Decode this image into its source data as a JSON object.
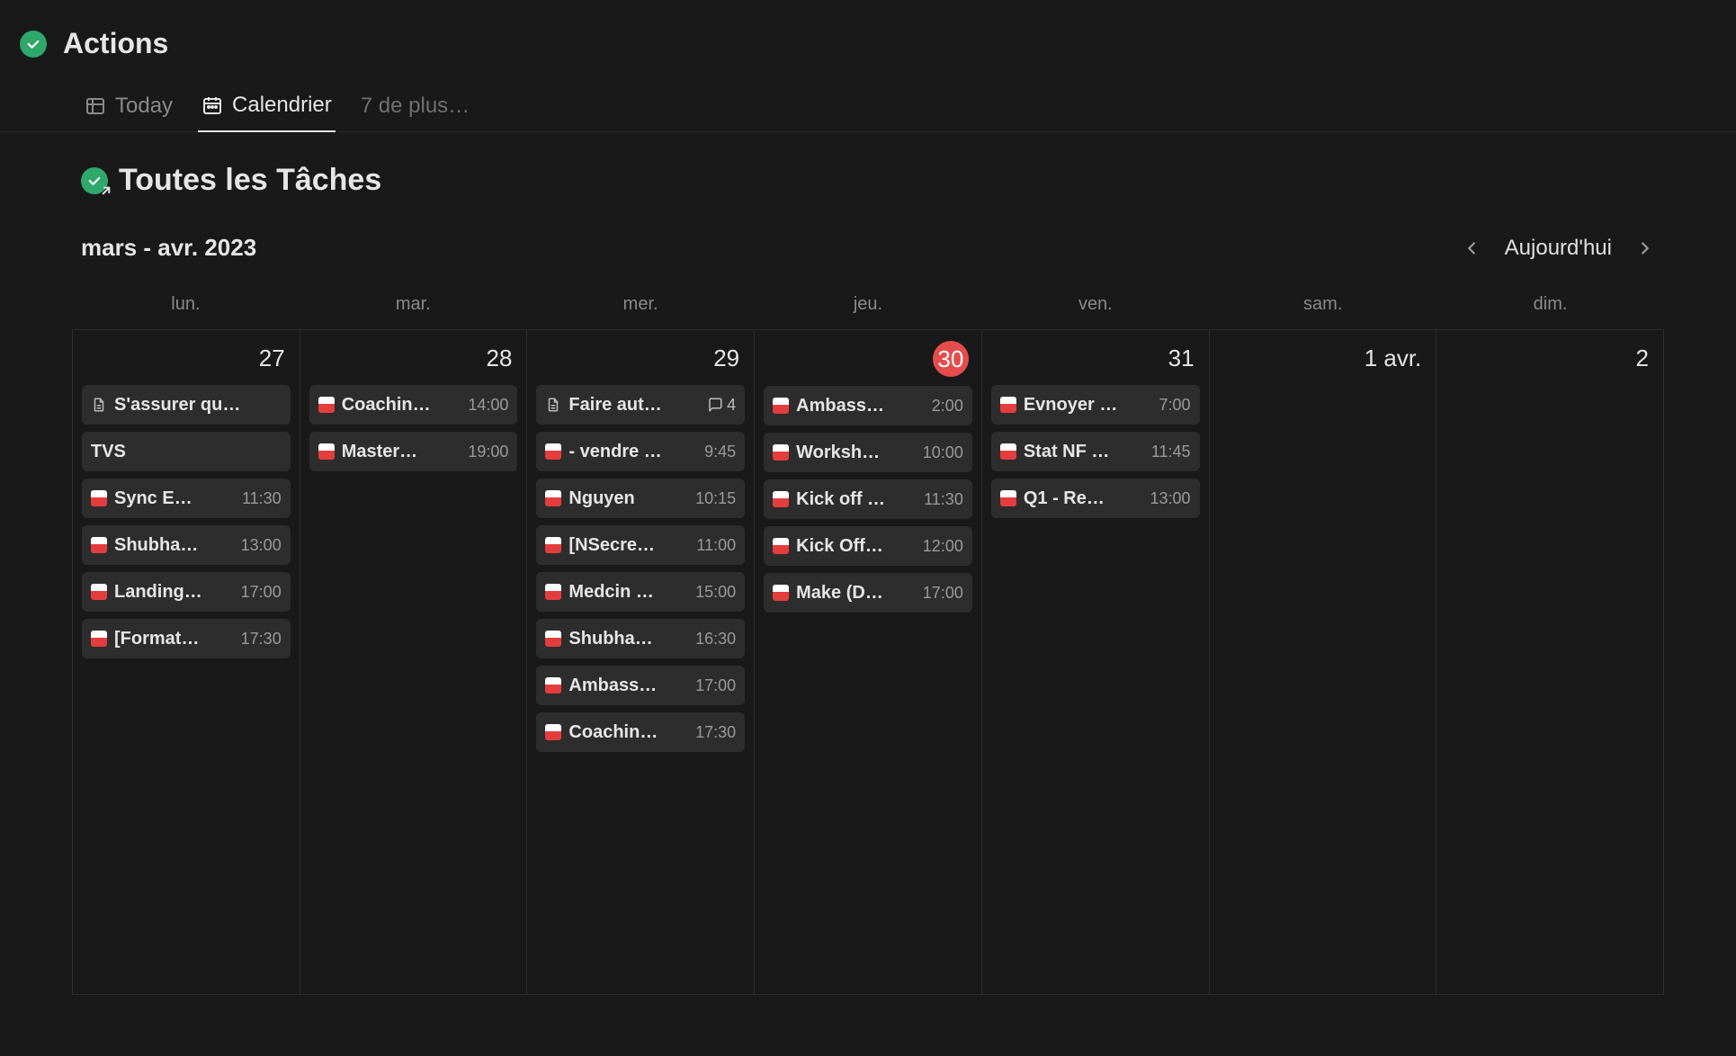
{
  "header": {
    "title": "Actions"
  },
  "tabs": {
    "today": "Today",
    "calendar": "Calendrier",
    "more": "7 de plus…"
  },
  "subheader": {
    "title": "Toutes les Tâches"
  },
  "nav": {
    "month_label": "mars - avr. 2023",
    "today_label": "Aujourd'hui"
  },
  "dow": [
    "lun.",
    "mar.",
    "mer.",
    "jeu.",
    "ven.",
    "sam.",
    "dim."
  ],
  "days": [
    {
      "num": "27",
      "today": false,
      "events": [
        {
          "icon": "doc",
          "title": "S'assurer qu…",
          "time": ""
        },
        {
          "icon": "none",
          "title": "TVS",
          "time": ""
        },
        {
          "icon": "cal",
          "title": "Sync E…",
          "time": "11:30"
        },
        {
          "icon": "cal",
          "title": "Shubha…",
          "time": "13:00"
        },
        {
          "icon": "cal",
          "title": "Landing…",
          "time": "17:00"
        },
        {
          "icon": "cal",
          "title": "[Format…",
          "time": "17:30"
        }
      ]
    },
    {
      "num": "28",
      "today": false,
      "events": [
        {
          "icon": "cal",
          "title": "Coachin…",
          "time": "14:00"
        },
        {
          "icon": "cal",
          "title": "Master…",
          "time": "19:00"
        }
      ]
    },
    {
      "num": "29",
      "today": false,
      "events": [
        {
          "icon": "doc",
          "title": "Faire aut…",
          "comment": "4"
        },
        {
          "icon": "cal",
          "title": "- vendre …",
          "time": "9:45"
        },
        {
          "icon": "cal",
          "title": "Nguyen",
          "time": "10:15"
        },
        {
          "icon": "cal",
          "title": "[NSecre…",
          "time": "11:00"
        },
        {
          "icon": "cal",
          "title": "Medcin …",
          "time": "15:00"
        },
        {
          "icon": "cal",
          "title": "Shubha…",
          "time": "16:30"
        },
        {
          "icon": "cal",
          "title": "Ambass…",
          "time": "17:00"
        },
        {
          "icon": "cal",
          "title": "Coachin…",
          "time": "17:30"
        }
      ]
    },
    {
      "num": "30",
      "today": true,
      "events": [
        {
          "icon": "cal",
          "title": "Ambass…",
          "time": "2:00"
        },
        {
          "icon": "cal",
          "title": "Worksh…",
          "time": "10:00"
        },
        {
          "icon": "cal",
          "title": "Kick off …",
          "time": "11:30"
        },
        {
          "icon": "cal",
          "title": "Kick Off…",
          "time": "12:00"
        },
        {
          "icon": "cal",
          "title": "Make (D…",
          "time": "17:00"
        }
      ]
    },
    {
      "num": "31",
      "today": false,
      "events": [
        {
          "icon": "cal",
          "title": "Evnoyer …",
          "time": "7:00"
        },
        {
          "icon": "cal",
          "title": "Stat NF …",
          "time": "11:45"
        },
        {
          "icon": "cal",
          "title": "Q1 - Re…",
          "time": "13:00"
        }
      ]
    },
    {
      "num": "1 avr.",
      "today": false,
      "events": []
    },
    {
      "num": "2",
      "today": false,
      "events": []
    }
  ]
}
